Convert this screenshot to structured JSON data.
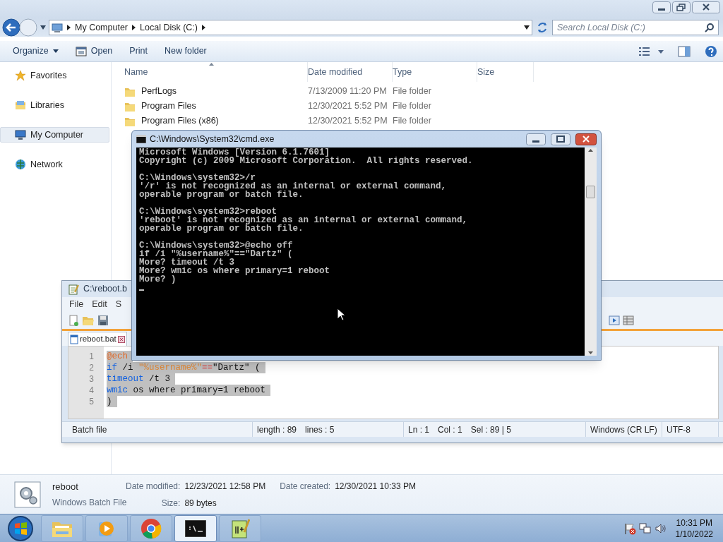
{
  "explorer": {
    "address": [
      "My Computer",
      "Local Disk (C:)"
    ],
    "search": {
      "placeholder": "Search Local Disk (C:)"
    },
    "toolbar": [
      {
        "label": "Organize",
        "kind": "menu"
      },
      {
        "label": "Open",
        "kind": "open"
      },
      {
        "label": "Print",
        "kind": "plain"
      },
      {
        "label": "New folder",
        "kind": "plain"
      }
    ],
    "sidebar": [
      {
        "label": "Favorites",
        "kind": "star",
        "selected": false
      },
      {
        "label": "Libraries",
        "kind": "library",
        "selected": false
      },
      {
        "label": "My Computer",
        "kind": "computer",
        "selected": true
      },
      {
        "label": "Network",
        "kind": "network",
        "selected": false
      }
    ],
    "columns": [
      "Name",
      "Date modified",
      "Type",
      "Size"
    ],
    "rows": [
      {
        "name": "PerfLogs",
        "date": "7/13/2009 11:20 PM",
        "type": "File folder"
      },
      {
        "name": "Program Files",
        "date": "12/30/2021 5:52 PM",
        "type": "File folder"
      },
      {
        "name": "Program Files (x86)",
        "date": "12/30/2021 5:52 PM",
        "type": "File folder"
      }
    ],
    "details": {
      "name": "reboot",
      "type": "Windows Batch File",
      "fields": [
        {
          "label": "Date modified:",
          "value": "12/23/2021 12:58 PM"
        },
        {
          "label": "Date created:",
          "value": "12/30/2021 10:33 PM"
        },
        {
          "label": "Size:",
          "value": "89 bytes"
        }
      ]
    }
  },
  "notepad": {
    "title": "C:\\reboot.b",
    "menu": [
      "File",
      "Edit",
      "S"
    ],
    "tab": "reboot.bat",
    "lines": [
      {
        "number": "1",
        "tokens": [
          {
            "kind": "command",
            "text": "@ech"
          }
        ]
      },
      {
        "number": "2",
        "tokens": [
          {
            "kind": "keyword",
            "text": "if"
          },
          {
            "kind": "plain",
            "text": " /i "
          },
          {
            "kind": "variable",
            "text": "\"%username%\""
          },
          {
            "kind": "operator",
            "text": "=="
          },
          {
            "kind": "plain",
            "text": "\"Dartz\" ("
          }
        ]
      },
      {
        "number": "3",
        "tokens": [
          {
            "kind": "keyword",
            "text": "timeout"
          },
          {
            "kind": "plain",
            "text": " /t 3"
          }
        ]
      },
      {
        "number": "4",
        "tokens": [
          {
            "kind": "keyword",
            "text": "wmic"
          },
          {
            "kind": "plain",
            "text": " os where primary=1 reboot"
          }
        ]
      },
      {
        "number": "5",
        "tokens": [
          {
            "kind": "plain",
            "text": ")"
          }
        ]
      }
    ],
    "status": {
      "type": "Batch file",
      "length": "length : 89",
      "lines": "lines : 5",
      "ln": "Ln : 1",
      "col": "Col : 1",
      "sel": "Sel : 89 | 5",
      "eol": "Windows (CR LF)",
      "encoding": "UTF-8"
    }
  },
  "cmd": {
    "title": "C:\\Windows\\System32\\cmd.exe",
    "cursor_visible": true,
    "blocks": [
      [
        "Microsoft Windows [Version 6.1.7601]",
        "Copyright (c) 2009 Microsoft Corporation.  All rights reserved."
      ],
      [
        "C:\\Windows\\system32>/r",
        "'/r' is not recognized as an internal or external command,",
        "operable program or batch file."
      ],
      [
        "C:\\Windows\\system32>reboot",
        "'reboot' is not recognized as an internal or external command,",
        "operable program or batch file."
      ],
      [
        "C:\\Windows\\system32>@echo off",
        "if /i \"%username%\"==\"Dartz\" (",
        "More? timeout /t 3",
        "More? wmic os where primary=1 reboot",
        "More? )"
      ]
    ]
  },
  "taskbar": {
    "apps": [
      {
        "kind": "explorer",
        "selected": false
      },
      {
        "kind": "media",
        "selected": false
      },
      {
        "kind": "browser",
        "selected": false
      },
      {
        "kind": "cmd",
        "selected": true
      },
      {
        "kind": "notepad",
        "selected": false
      }
    ],
    "time": "10:31 PM",
    "date": "1/10/2022"
  }
}
